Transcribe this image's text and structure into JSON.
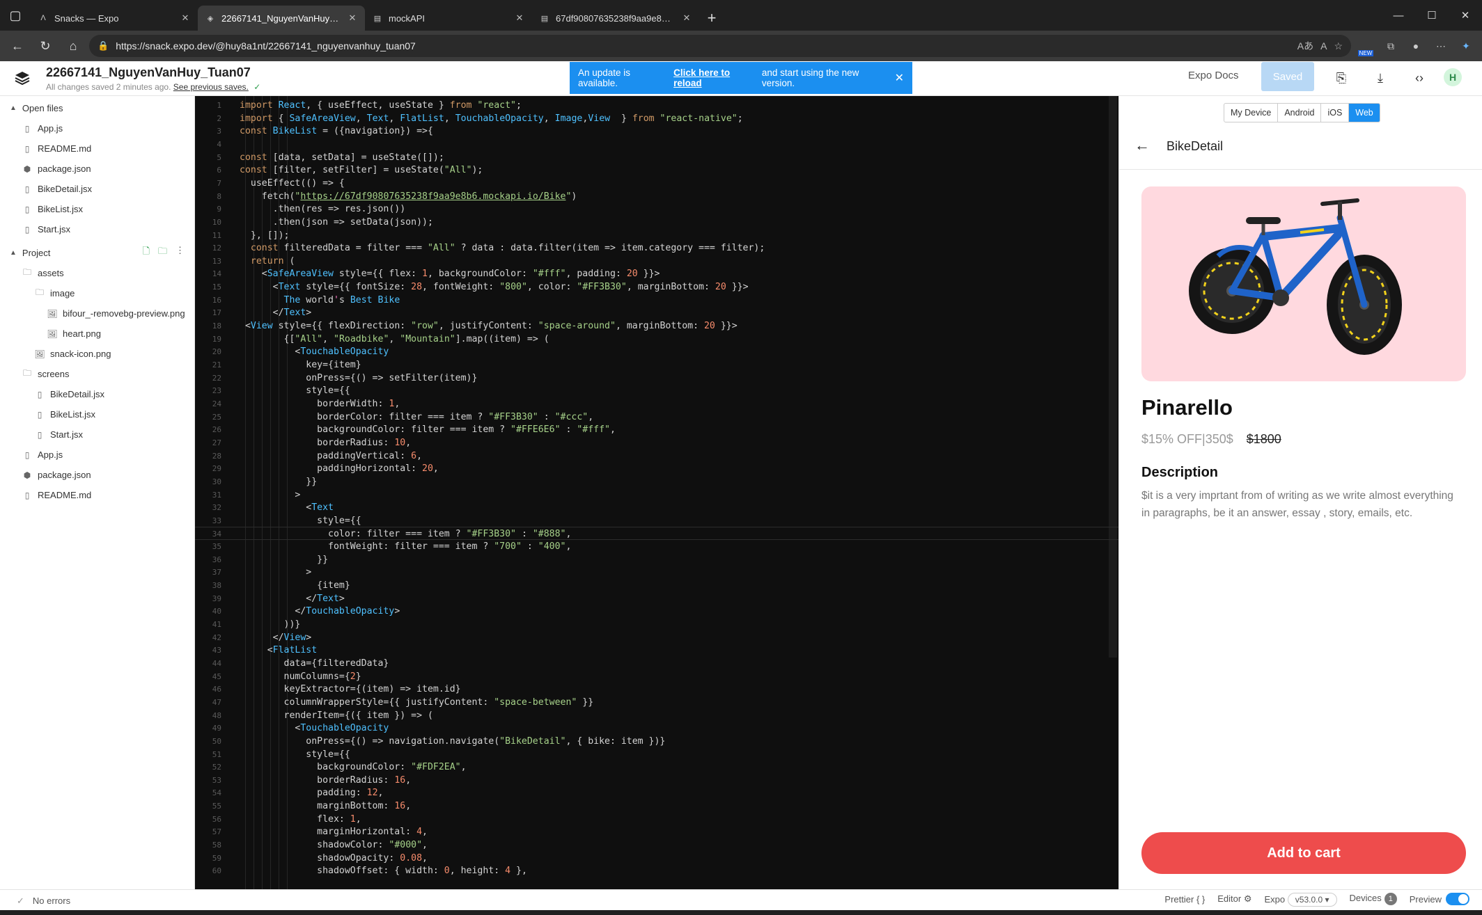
{
  "browser": {
    "tabs": [
      {
        "title": "Snacks — Expo",
        "icon": "expo-icon",
        "active": false
      },
      {
        "title": "22667141_NguyenVanHuy_Tuan0",
        "icon": "snack-icon",
        "active": true
      },
      {
        "title": "mockAPI",
        "icon": "api-icon",
        "active": false
      },
      {
        "title": "67df90807635238f9aa9e8b6.moc",
        "icon": "api-icon",
        "active": false
      }
    ],
    "url": "https://snack.expo.dev/@huy8a1nt/22667141_nguyenvanhuy_tuan07",
    "new_badge": "NEW"
  },
  "header": {
    "project_name": "22667141_NguyenVanHuy_Tuan07",
    "save_status": "All changes saved 2 minutes ago.",
    "previous_saves": "See previous saves.",
    "toast_prefix": "An update is available.",
    "toast_link": "Click here to reload",
    "toast_suffix": "and start using the new version.",
    "expo_docs": "Expo Docs",
    "saved_label": "Saved",
    "avatar_initial": "H"
  },
  "sidebar": {
    "open_files_label": "Open files",
    "open_files": [
      "App.js",
      "README.md",
      "package.json",
      "BikeDetail.jsx",
      "BikeList.jsx",
      "Start.jsx"
    ],
    "project_label": "Project",
    "tree": [
      {
        "name": "assets",
        "type": "folder",
        "depth": 1
      },
      {
        "name": "image",
        "type": "folder",
        "depth": 2
      },
      {
        "name": "bifour_-removebg-preview.png",
        "type": "image",
        "depth": 3
      },
      {
        "name": "heart.png",
        "type": "image",
        "depth": 3
      },
      {
        "name": "snack-icon.png",
        "type": "image",
        "depth": 2
      },
      {
        "name": "screens",
        "type": "folder",
        "depth": 1
      },
      {
        "name": "BikeDetail.jsx",
        "type": "file",
        "depth": 2
      },
      {
        "name": "BikeList.jsx",
        "type": "file",
        "depth": 2
      },
      {
        "name": "Start.jsx",
        "type": "file",
        "depth": 2
      },
      {
        "name": "App.js",
        "type": "file",
        "depth": 1
      },
      {
        "name": "package.json",
        "type": "pkg",
        "depth": 1
      },
      {
        "name": "README.md",
        "type": "file",
        "depth": 1
      }
    ]
  },
  "editor": {
    "current_line": 34,
    "lines": [
      [
        [
          "kw",
          "import "
        ],
        [
          "tg",
          "React"
        ],
        [
          "cm",
          ", { useEffect, useState } "
        ],
        [
          "kw",
          "from "
        ],
        [
          "str",
          "\"react\""
        ],
        [
          "cm",
          ";"
        ]
      ],
      [
        [
          "kw",
          "import "
        ],
        [
          "cm",
          "{ "
        ],
        [
          "tg",
          "SafeAreaView"
        ],
        [
          "cm",
          ", "
        ],
        [
          "tg",
          "Text"
        ],
        [
          "cm",
          ", "
        ],
        [
          "tg",
          "FlatList"
        ],
        [
          "cm",
          ", "
        ],
        [
          "tg",
          "TouchableOpacity"
        ],
        [
          "cm",
          ", "
        ],
        [
          "tg",
          "Image"
        ],
        [
          "cm",
          ","
        ],
        [
          "tg",
          "View"
        ],
        [
          "cm",
          "  } "
        ],
        [
          "kw",
          "from "
        ],
        [
          "str",
          "\"react-native\""
        ],
        [
          "cm",
          ";"
        ]
      ],
      [
        [
          "kw",
          "const "
        ],
        [
          "tg",
          "BikeList"
        ],
        [
          "cm",
          " = ({navigation}) =>{"
        ]
      ],
      [],
      [
        [
          "kw",
          "const "
        ],
        [
          "cm",
          "[data, setData] = useState([]);"
        ]
      ],
      [
        [
          "kw",
          "const "
        ],
        [
          "cm",
          "[filter, setFilter] = useState("
        ],
        [
          "str",
          "\"All\""
        ],
        [
          "cm",
          ");"
        ]
      ],
      [
        [
          "cm",
          "  useEffect(() => {"
        ]
      ],
      [
        [
          "cm",
          "    fetch("
        ],
        [
          "str",
          "\""
        ],
        [
          "url",
          "https://67df90807635238f9aa9e8b6.mockapi.io/Bike"
        ],
        [
          "str",
          "\""
        ],
        [
          "cm",
          ")"
        ]
      ],
      [
        [
          "cm",
          "      .then(res => res.json())"
        ]
      ],
      [
        [
          "cm",
          "      .then(json => setData(json));"
        ]
      ],
      [
        [
          "cm",
          "  }, []);"
        ]
      ],
      [
        [
          "kw",
          "  const "
        ],
        [
          "cm",
          "filteredData = filter === "
        ],
        [
          "str",
          "\"All\""
        ],
        [
          "cm",
          " ? data : data.filter(item => item.category === filter);"
        ]
      ],
      [
        [
          "kw",
          "  return "
        ],
        [
          "cm",
          "("
        ]
      ],
      [
        [
          "cm",
          "    <"
        ],
        [
          "tg",
          "SafeAreaView"
        ],
        [
          "cm",
          " style={{ flex: "
        ],
        [
          "num",
          "1"
        ],
        [
          "cm",
          ", backgroundColor: "
        ],
        [
          "str",
          "\"#fff\""
        ],
        [
          "cm",
          ", padding: "
        ],
        [
          "num",
          "20"
        ],
        [
          "cm",
          " }}>"
        ]
      ],
      [
        [
          "cm",
          "      <"
        ],
        [
          "tg",
          "Text"
        ],
        [
          "cm",
          " style={{ fontSize: "
        ],
        [
          "num",
          "28"
        ],
        [
          "cm",
          ", fontWeight: "
        ],
        [
          "str",
          "\"800\""
        ],
        [
          "cm",
          ", color: "
        ],
        [
          "str",
          "\"#FF3B30\""
        ],
        [
          "cm",
          ", marginBottom: "
        ],
        [
          "num",
          "20"
        ],
        [
          "cm",
          " }}>"
        ]
      ],
      [
        [
          "tg",
          "        The "
        ],
        [
          "cm",
          "world"
        ],
        [
          "pink",
          "'"
        ],
        [
          "cm",
          "s "
        ],
        [
          "tg",
          "Best Bike"
        ]
      ],
      [
        [
          "cm",
          "      </"
        ],
        [
          "tg",
          "Text"
        ],
        [
          "cm",
          ">"
        ]
      ],
      [
        [
          "cm",
          " <"
        ],
        [
          "tg",
          "View"
        ],
        [
          "cm",
          " style={{ flexDirection: "
        ],
        [
          "str",
          "\"row\""
        ],
        [
          "cm",
          ", justifyContent: "
        ],
        [
          "str",
          "\"space-around\""
        ],
        [
          "cm",
          ", marginBottom: "
        ],
        [
          "num",
          "20"
        ],
        [
          "cm",
          " }}>"
        ]
      ],
      [
        [
          "cm",
          "        {["
        ],
        [
          "str",
          "\"All\""
        ],
        [
          "cm",
          ", "
        ],
        [
          "str",
          "\"Roadbike\""
        ],
        [
          "cm",
          ", "
        ],
        [
          "str",
          "\"Mountain\""
        ],
        [
          "cm",
          "].map((item) => ("
        ]
      ],
      [
        [
          "cm",
          "          <"
        ],
        [
          "tg",
          "TouchableOpacity"
        ]
      ],
      [
        [
          "cm",
          "            key={item}"
        ]
      ],
      [
        [
          "cm",
          "            onPress={() => setFilter(item)}"
        ]
      ],
      [
        [
          "cm",
          "            style={{"
        ]
      ],
      [
        [
          "cm",
          "              borderWidth: "
        ],
        [
          "num",
          "1"
        ],
        [
          "cm",
          ","
        ]
      ],
      [
        [
          "cm",
          "              borderColor: filter === item ? "
        ],
        [
          "str",
          "\"#FF3B30\""
        ],
        [
          "cm",
          " : "
        ],
        [
          "str",
          "\"#ccc\""
        ],
        [
          "cm",
          ","
        ]
      ],
      [
        [
          "cm",
          "              backgroundColor: filter === item ? "
        ],
        [
          "str",
          "\"#FFE6E6\""
        ],
        [
          "cm",
          " : "
        ],
        [
          "str",
          "\"#fff\""
        ],
        [
          "cm",
          ","
        ]
      ],
      [
        [
          "cm",
          "              borderRadius: "
        ],
        [
          "num",
          "10"
        ],
        [
          "cm",
          ","
        ]
      ],
      [
        [
          "cm",
          "              paddingVertical: "
        ],
        [
          "num",
          "6"
        ],
        [
          "cm",
          ","
        ]
      ],
      [
        [
          "cm",
          "              paddingHorizontal: "
        ],
        [
          "num",
          "20"
        ],
        [
          "cm",
          ","
        ]
      ],
      [
        [
          "cm",
          "            }}"
        ]
      ],
      [
        [
          "cm",
          "          >"
        ]
      ],
      [
        [
          "cm",
          "            <"
        ],
        [
          "tg",
          "Text"
        ]
      ],
      [
        [
          "cm",
          "              style={{"
        ]
      ],
      [
        [
          "cm",
          "                color: filter === item ? "
        ],
        [
          "str",
          "\"#FF3B30\""
        ],
        [
          "cm",
          " : "
        ],
        [
          "str",
          "\"#888\""
        ],
        [
          "cm",
          ","
        ]
      ],
      [
        [
          "cm",
          "                fontWeight: filter === item ? "
        ],
        [
          "str",
          "\"700\""
        ],
        [
          "cm",
          " : "
        ],
        [
          "str",
          "\"400\""
        ],
        [
          "cm",
          ","
        ]
      ],
      [
        [
          "cm",
          "              }}"
        ]
      ],
      [
        [
          "cm",
          "            >"
        ]
      ],
      [
        [
          "cm",
          "              {item}"
        ]
      ],
      [
        [
          "cm",
          "            </"
        ],
        [
          "tg",
          "Text"
        ],
        [
          "cm",
          ">"
        ]
      ],
      [
        [
          "cm",
          "          </"
        ],
        [
          "tg",
          "TouchableOpacity"
        ],
        [
          "cm",
          ">"
        ]
      ],
      [
        [
          "cm",
          "        ))}"
        ]
      ],
      [
        [
          "cm",
          "      </"
        ],
        [
          "tg",
          "View"
        ],
        [
          "cm",
          ">"
        ]
      ],
      [
        [
          "cm",
          "     <"
        ],
        [
          "tg",
          "FlatList"
        ]
      ],
      [
        [
          "cm",
          "        data={filteredData}"
        ]
      ],
      [
        [
          "cm",
          "        numColumns={"
        ],
        [
          "num",
          "2"
        ],
        [
          "cm",
          "}"
        ]
      ],
      [
        [
          "cm",
          "        keyExtractor={(item) => item.id}"
        ]
      ],
      [
        [
          "cm",
          "        columnWrapperStyle={{ justifyContent: "
        ],
        [
          "str",
          "\"space-between\""
        ],
        [
          "cm",
          " }}"
        ]
      ],
      [
        [
          "cm",
          "        renderItem={({ item }) => ("
        ]
      ],
      [
        [
          "cm",
          "          <"
        ],
        [
          "tg",
          "TouchableOpacity"
        ]
      ],
      [
        [
          "cm",
          "            onPress={() => navigation.navigate("
        ],
        [
          "str",
          "\"BikeDetail\""
        ],
        [
          "cm",
          ", { bike: item })}"
        ]
      ],
      [
        [
          "cm",
          "            style={{"
        ]
      ],
      [
        [
          "cm",
          "              backgroundColor: "
        ],
        [
          "str",
          "\"#FDF2EA\""
        ],
        [
          "cm",
          ","
        ]
      ],
      [
        [
          "cm",
          "              borderRadius: "
        ],
        [
          "num",
          "16"
        ],
        [
          "cm",
          ","
        ]
      ],
      [
        [
          "cm",
          "              padding: "
        ],
        [
          "num",
          "12"
        ],
        [
          "cm",
          ","
        ]
      ],
      [
        [
          "cm",
          "              marginBottom: "
        ],
        [
          "num",
          "16"
        ],
        [
          "cm",
          ","
        ]
      ],
      [
        [
          "cm",
          "              flex: "
        ],
        [
          "num",
          "1"
        ],
        [
          "cm",
          ","
        ]
      ],
      [
        [
          "cm",
          "              marginHorizontal: "
        ],
        [
          "num",
          "4"
        ],
        [
          "cm",
          ","
        ]
      ],
      [
        [
          "cm",
          "              shadowColor: "
        ],
        [
          "str",
          "\"#000\""
        ],
        [
          "cm",
          ","
        ]
      ],
      [
        [
          "cm",
          "              shadowOpacity: "
        ],
        [
          "num",
          "0.08"
        ],
        [
          "cm",
          ","
        ]
      ],
      [
        [
          "cm",
          "              shadowOffset: { width: "
        ],
        [
          "num",
          "0"
        ],
        [
          "cm",
          ", height: "
        ],
        [
          "num",
          "4"
        ],
        [
          "cm",
          " },"
        ]
      ]
    ]
  },
  "preview": {
    "tabs": [
      "My Device",
      "Android",
      "iOS",
      "Web"
    ],
    "active_tab": "Web",
    "screen_title": "BikeDetail",
    "bike_name": "Pinarello",
    "price_discount": "$15% OFF|350$",
    "price_old": "$1800",
    "description_title": "Description",
    "description_text": "$it is a very imprtant from of writing as we write almost everything in paragraphs, be it an answer, essay , story, emails, etc.",
    "add_to_cart": "Add to cart",
    "colors": {
      "image_bg": "#ffd9df",
      "cart_button": "#ee4c4c",
      "bike_frame": "#1f63c9",
      "bike_accent": "#f2d21b"
    }
  },
  "status": {
    "errors": "No errors",
    "prettier": "Prettier",
    "editor": "Editor",
    "expo": "Expo",
    "version": "v53.0.0",
    "devices": "Devices",
    "devices_count": "1",
    "preview": "Preview"
  }
}
